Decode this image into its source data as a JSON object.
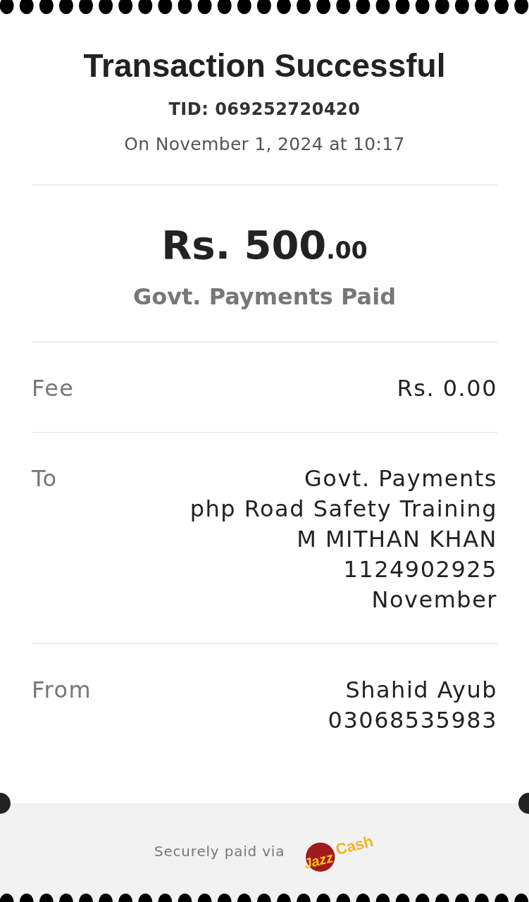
{
  "header": {
    "title": "Transaction Successful",
    "tid": "TID: 069252720420",
    "date": "On November 1, 2024 at 10:17"
  },
  "amount": {
    "main": "Rs. 500",
    "decimals": ".00",
    "description": "Govt. Payments Paid"
  },
  "details": [
    {
      "label": "Fee",
      "lines": [
        "Rs. 0.00"
      ]
    },
    {
      "label": "To",
      "lines": [
        "Govt. Payments",
        "php Road Safety Training",
        "M MITHAN KHAN",
        "1124902925",
        "November"
      ]
    },
    {
      "label": "From",
      "lines": [
        "Shahid Ayub",
        "03068535983"
      ]
    }
  ],
  "footer": {
    "note": "Securely paid via",
    "logo_words": [
      "Jazz",
      "Cash"
    ]
  }
}
